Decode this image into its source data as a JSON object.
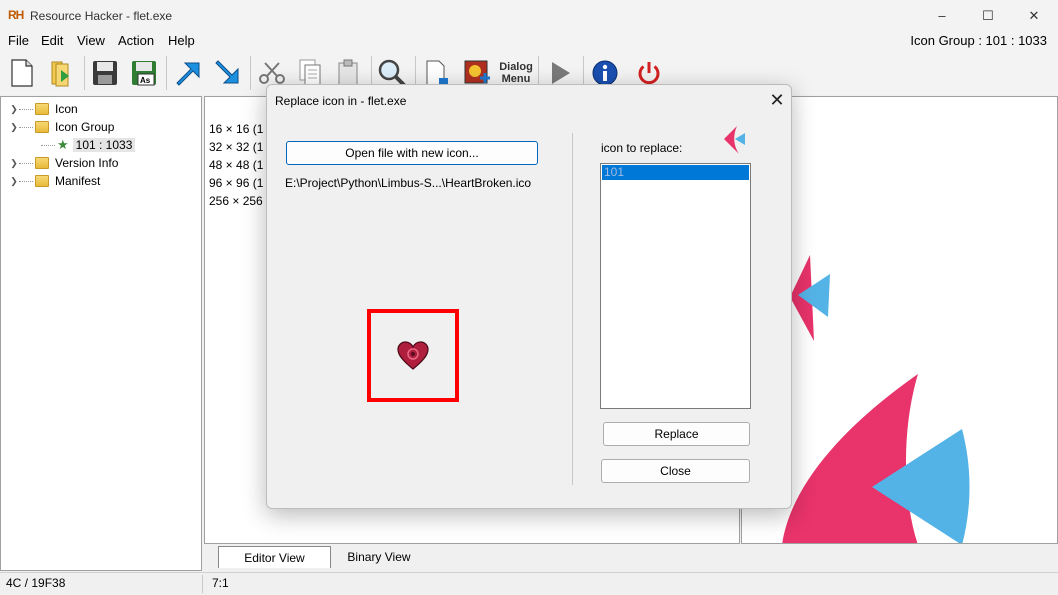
{
  "window": {
    "app_logo": "RH",
    "title": "Resource Hacker - flet.exe",
    "resource_id": "Icon Group : 101 : 1033",
    "minimize_glyph": "–",
    "maximize_glyph": "☐",
    "close_glyph": "✕"
  },
  "menu": [
    "File",
    "Edit",
    "View",
    "Action",
    "Help"
  ],
  "toolbar": {
    "dialog_menu_label": "Dialog Menu"
  },
  "tree": {
    "items": [
      {
        "label": "Icon",
        "expanded": false
      },
      {
        "label": "Icon Group",
        "expanded": true
      },
      {
        "label": "101 : 1033",
        "selected": true
      },
      {
        "label": "Version Info",
        "expanded": false
      },
      {
        "label": "Manifest",
        "expanded": false
      }
    ]
  },
  "editor": {
    "lines": [
      "16 × 16 (1",
      "32 × 32 (1",
      "48 × 48 (1",
      "96 × 96 (1",
      "256 × 256"
    ]
  },
  "tabs": [
    "Editor View",
    "Binary View"
  ],
  "status": {
    "left": "4C / 19F38",
    "right": "7:1"
  },
  "dialog": {
    "title": "Replace icon in - flet.exe",
    "open_button": "Open file with new icon...",
    "file_path": "E:\\Project\\Python\\Limbus-S...\\HeartBroken.ico",
    "replace_label": "icon to replace:",
    "list_items": [
      "101"
    ],
    "replace_button": "Replace",
    "close_button": "Close"
  },
  "colors": {
    "accent_blue": "#0078d7",
    "highlight_red": "#ff0000",
    "brand_pink": "#e8336b",
    "brand_blue": "#54b3e6"
  }
}
